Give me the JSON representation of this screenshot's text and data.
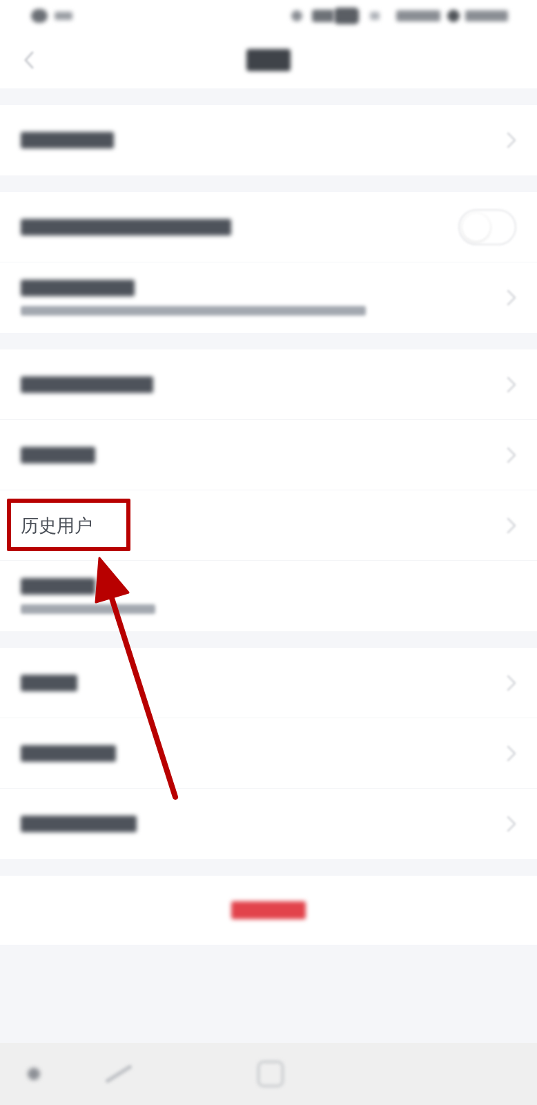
{
  "sections": [
    {
      "rows": [
        {
          "kind": "link",
          "subtitle": false,
          "highlighted": false
        }
      ]
    },
    {
      "rows": [
        {
          "kind": "toggle",
          "on": false,
          "subtitle": false,
          "highlighted": false
        },
        {
          "kind": "link",
          "subtitle": true,
          "highlighted": false
        }
      ]
    },
    {
      "rows": [
        {
          "kind": "link",
          "subtitle": false,
          "highlighted": false
        },
        {
          "kind": "link",
          "subtitle": false,
          "highlighted": false
        },
        {
          "kind": "link",
          "label": "历史用户",
          "subtitle": false,
          "highlighted": true
        },
        {
          "kind": "plain",
          "subtitle": true,
          "highlighted": false
        }
      ]
    },
    {
      "rows": [
        {
          "kind": "link",
          "subtitle": false,
          "highlighted": false
        },
        {
          "kind": "link",
          "subtitle": false,
          "highlighted": false
        },
        {
          "kind": "link",
          "subtitle": false,
          "highlighted": false
        }
      ]
    }
  ],
  "logout_button": {
    "kind": "blurred"
  }
}
